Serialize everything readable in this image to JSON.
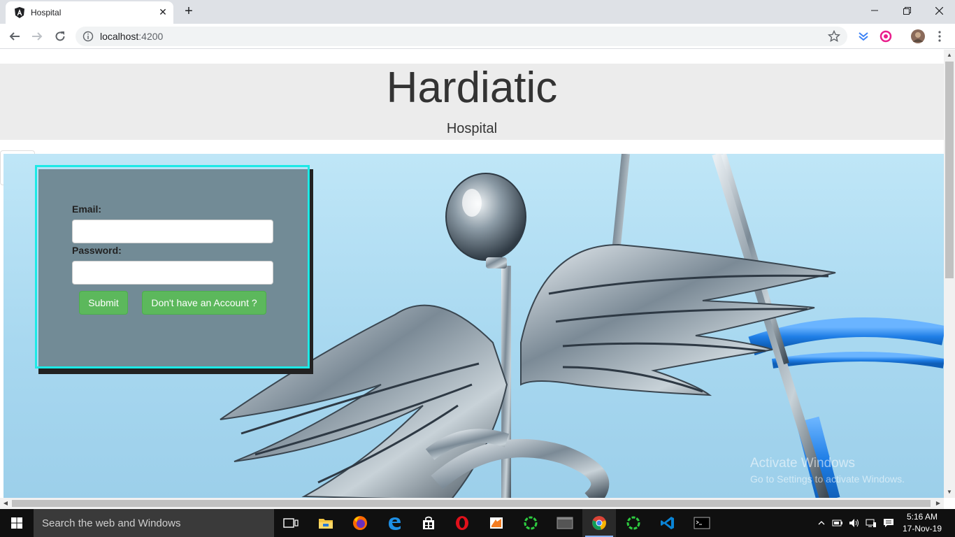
{
  "browser": {
    "tab_title": "Hospital",
    "address_host": "localhost",
    "address_port": ":4200"
  },
  "page": {
    "brand_title": "Hardiatic",
    "brand_subtitle": "Hospital",
    "login": {
      "email_label": "Email:",
      "email_value": "",
      "password_label": "Password:",
      "password_value": "",
      "submit_label": "Submit",
      "signup_label": "Don't have an Account ?"
    },
    "watermark_line1": "Activate Windows",
    "watermark_line2": "Go to Settings to activate Windows."
  },
  "taskbar": {
    "search_placeholder": "Search the web and Windows",
    "time": "5:16 AM",
    "date": "17-Nov-19",
    "apps": [
      "task-view-icon",
      "file-explorer-icon",
      "firefox-icon",
      "edge-icon",
      "store-icon",
      "opera-icon",
      "xampp-icon",
      "spinner-app-icon",
      "terminal-window-icon",
      "chrome-icon",
      "spinner-app-icon-2",
      "vscode-icon",
      "cmd-icon"
    ]
  },
  "colors": {
    "accent_cyan": "#1de9e6",
    "button_green": "#5cb85c",
    "header_gray": "#ececec"
  }
}
